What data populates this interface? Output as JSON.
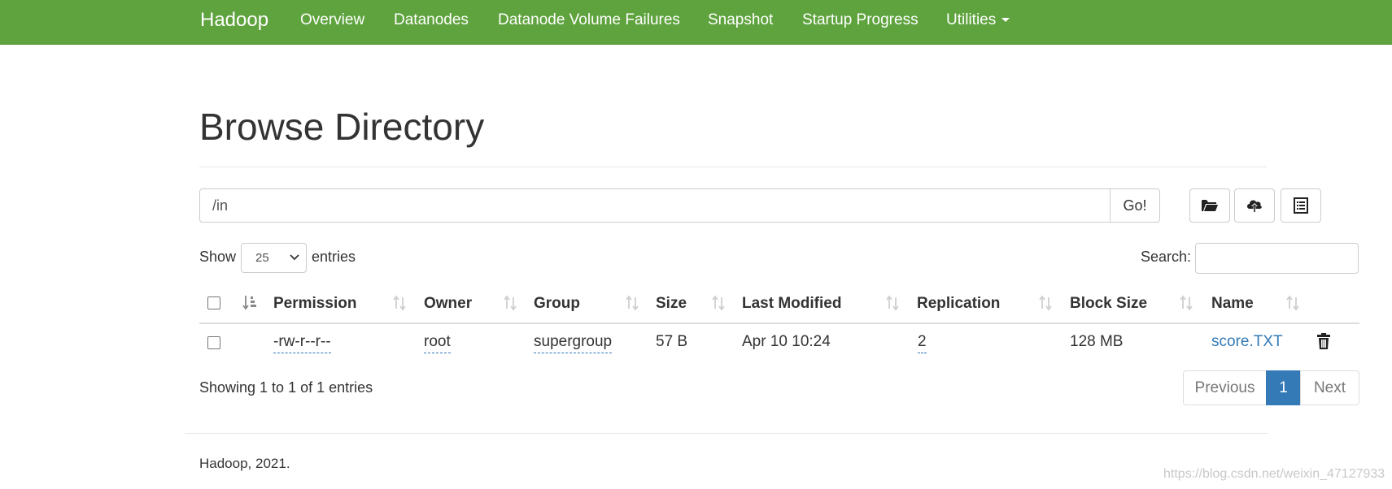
{
  "navbar": {
    "brand": "Hadoop",
    "items": [
      {
        "label": "Overview"
      },
      {
        "label": "Datanodes"
      },
      {
        "label": "Datanode Volume Failures"
      },
      {
        "label": "Snapshot"
      },
      {
        "label": "Startup Progress"
      },
      {
        "label": "Utilities"
      }
    ]
  },
  "page": {
    "title": "Browse Directory"
  },
  "pathbar": {
    "value": "/in",
    "go_label": "Go!",
    "tools": [
      "folder-open-icon",
      "cloud-upload-icon",
      "list-alt-icon"
    ]
  },
  "listing": {
    "show_label": "Show",
    "page_size": "25",
    "entries_label": "entries",
    "search_label": "Search:",
    "search_value": ""
  },
  "table": {
    "columns": [
      "Permission",
      "Owner",
      "Group",
      "Size",
      "Last Modified",
      "Replication",
      "Block Size",
      "Name"
    ],
    "rows": [
      {
        "permission": "-rw-r--r--",
        "owner": "root",
        "group": "supergroup",
        "size": "57 B",
        "last_modified": "Apr 10 10:24",
        "replication": "2",
        "block_size": "128 MB",
        "name": "score.TXT"
      }
    ]
  },
  "pagination": {
    "info": "Showing 1 to 1 of 1 entries",
    "previous_label": "Previous",
    "current_page": "1",
    "next_label": "Next"
  },
  "footer": {
    "text": "Hadoop, 2021."
  },
  "watermark": "https://blog.csdn.net/weixin_47127933",
  "colors": {
    "navbar_bg": "#5fa33e",
    "link": "#337ab7",
    "active_page": "#337ab7"
  }
}
